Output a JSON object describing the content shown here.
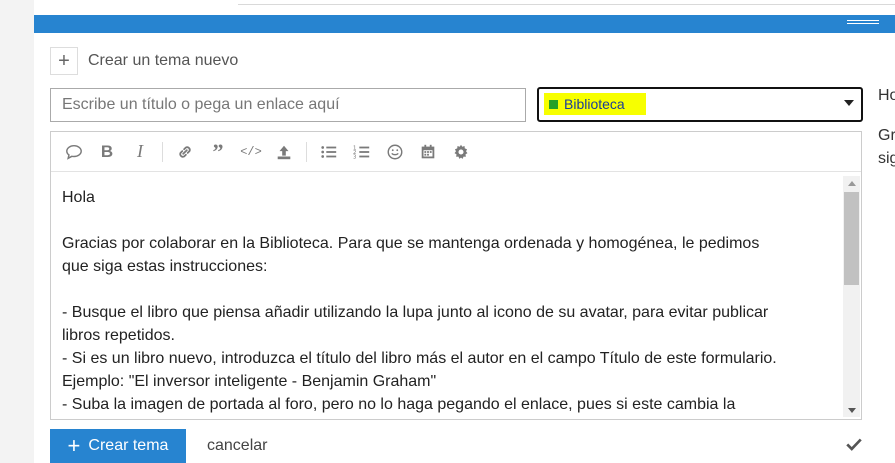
{
  "composer": {
    "action_label": "Crear un tema nuevo",
    "title_placeholder": "Escribe un título o pega un enlace aquí",
    "category": {
      "selected": "Biblioteca",
      "swatch_color": "#27a127",
      "highlight_color": "#f7ff00"
    },
    "toolbar_icons": [
      "quote-icon",
      "bold-icon",
      "italic-icon",
      "link-icon",
      "blockquote-icon",
      "code-icon",
      "upload-icon",
      "bullet-list-icon",
      "numbered-list-icon",
      "emoji-icon",
      "calendar-icon",
      "gear-icon"
    ],
    "body_lines": [
      "Hola",
      "",
      "Gracias por colaborar en la Biblioteca. Para que se mantenga ordenada y homogénea, le pedimos",
      "que siga estas instrucciones:",
      "",
      "- Busque el libro que piensa añadir utilizando la lupa junto al icono de su avatar, para evitar publicar",
      "libros repetidos.",
      "- Si es un libro nuevo, introduzca el título del libro más el autor en el campo Título de este formulario.",
      "Ejemplo: \"El inversor inteligente - Benjamin Graham\"",
      "- Suba la imagen de portada al foro, pero no lo haga pegando el enlace, pues si este cambia la"
    ],
    "create_button": "Crear tema",
    "cancel_label": "cancelar",
    "accent_color": "#2784d0"
  },
  "preview": {
    "line1": "Ho",
    "line2": "Gr",
    "line3": "sig"
  }
}
